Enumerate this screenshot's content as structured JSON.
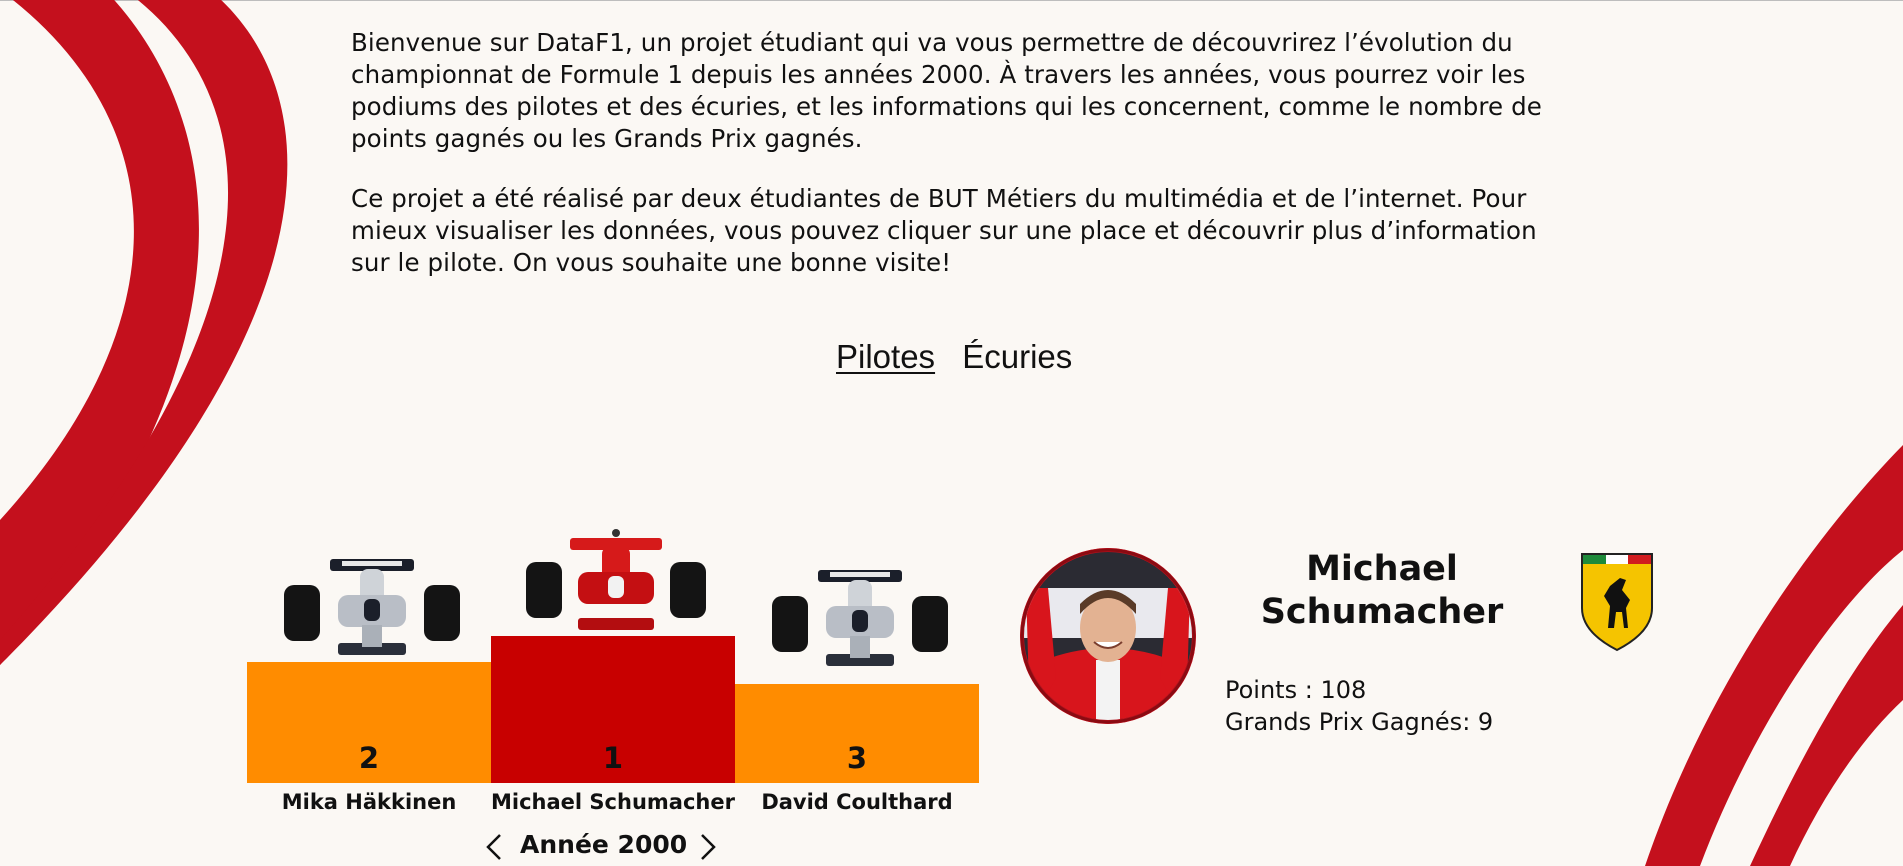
{
  "intro": {
    "paragraph1": "Bienvenue sur DataF1, un projet étudiant qui va vous permettre de découvrirez l’évolution du championnat de Formule 1 depuis les années 2000. À travers les années, vous pourrez voir les podiums des pilotes et des écuries, et les informations qui les concernent, comme le nombre de points gagnés ou les Grands Prix gagnés.",
    "paragraph2": "Ce projet a été réalisé par deux étudiantes de BUT Métiers du multimédia et de l’internet. Pour mieux visualiser les données, vous pouvez cliquer sur une place et découvrir plus d’information sur le pilote. On vous souhaite une bonne visite!"
  },
  "tabs": {
    "drivers": "Pilotes",
    "teams": "Écuries",
    "active": "drivers"
  },
  "podium": {
    "second": {
      "place": "2",
      "name": "Mika Häkkinen",
      "car": "mclaren-car-image"
    },
    "first": {
      "place": "1",
      "name": "Michael Schumacher",
      "car": "ferrari-car-image"
    },
    "third": {
      "place": "3",
      "name": "David Coulthard",
      "car": "mclaren-car-image"
    }
  },
  "year_nav": {
    "label": "Année 2000",
    "prev_icon": "chevron-left-icon",
    "next_icon": "chevron-right-icon"
  },
  "detail": {
    "name_line1": "Michael",
    "name_line2": "Schumacher",
    "points_label": "Points : 108",
    "wins_label": "Grands Prix Gagnés: 9",
    "photo": "driver-photo",
    "team_logo": "ferrari-logo"
  },
  "colors": {
    "background": "#fbf8f4",
    "accent_red": "#c4101d",
    "first_place": "#c80000",
    "other_places": "#ff8c00",
    "text": "#111111"
  }
}
